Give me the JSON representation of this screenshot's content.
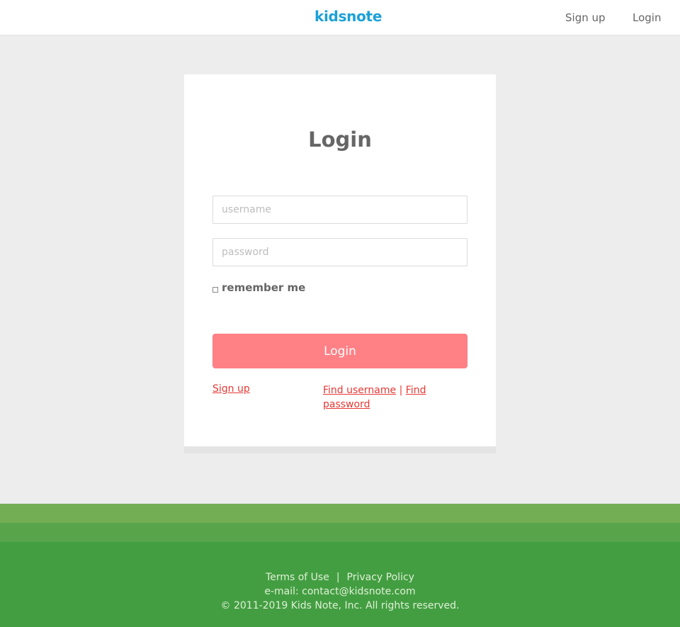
{
  "header": {
    "logo": "kidsnote",
    "nav": {
      "signup": "Sign up",
      "login": "Login"
    }
  },
  "login_form": {
    "title": "Login",
    "username_placeholder": "username",
    "password_placeholder": "password",
    "remember_label": "remember me",
    "remember_checked": false,
    "submit_label": "Login",
    "signup_link": "Sign up",
    "find_username_link": "Find username",
    "separator": "|",
    "find_password_link": "Find password"
  },
  "footer": {
    "terms": "Terms of Use",
    "separator": "|",
    "privacy": "Privacy Policy",
    "email": "e-mail: contact@kidsnote.com",
    "copyright": "© 2011-2019 Kids Note, Inc. All rights reserved."
  },
  "colors": {
    "brand": "#1ba1d8",
    "login_button": "#ff8085",
    "link": "#e53935",
    "footer_bg": "#439e42",
    "footer_band_light": "#73ae55",
    "footer_band_mid": "#58a44b",
    "page_bg": "#ededed"
  }
}
